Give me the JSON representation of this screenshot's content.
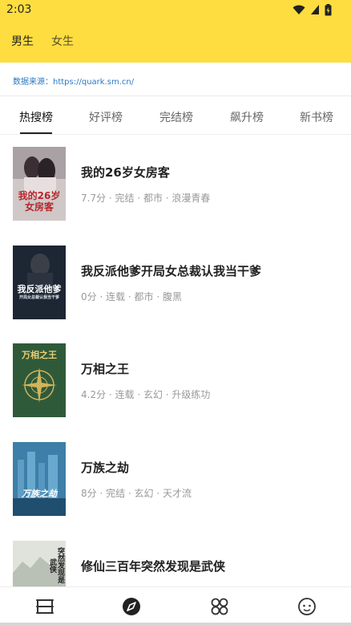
{
  "status_bar": {
    "time": "2:03",
    "icons": [
      "wifi-icon",
      "signal-icon",
      "battery-icon"
    ]
  },
  "header": {
    "tabs": [
      {
        "label": "男生",
        "active": true
      },
      {
        "label": "女生",
        "active": false
      }
    ],
    "background_color": "#FDDD3F"
  },
  "source": {
    "label": "数据来源：",
    "url": "https://quark.sm.cn/"
  },
  "rank_tabs": [
    {
      "label": "热搜榜",
      "active": true
    },
    {
      "label": "好评榜",
      "active": false
    },
    {
      "label": "完结榜",
      "active": false
    },
    {
      "label": "飙升榜",
      "active": false
    },
    {
      "label": "新书榜",
      "active": false
    }
  ],
  "books": [
    {
      "title": "我的26岁女房客",
      "meta": "7.7分 · 完结 · 都市 · 浪漫青春",
      "cover_text": "我的26岁女房客",
      "cover_color": "#c9c2c0"
    },
    {
      "title": "我反派他爹开局女总裁认我当干爹",
      "meta": "0分 · 连载 · 都市 · 腹黑",
      "cover_text": "我反派他爹",
      "cover_sub": "开局女总裁认我当干爹",
      "cover_color": "#1d2633"
    },
    {
      "title": "万相之王",
      "meta": "4.2分 · 连载 · 玄幻 · 升级练功",
      "cover_text": "万相之王",
      "cover_color": "#2f5a3a"
    },
    {
      "title": "万族之劫",
      "meta": "8分 · 完结 · 玄幻 · 天才流",
      "cover_text": "万族之劫",
      "cover_color": "#3d7fa8"
    },
    {
      "title": "修仙三百年突然发现是武侠",
      "meta": "",
      "cover_text": "突然发现是武侠",
      "cover_color": "#dfe3dc"
    }
  ],
  "bottom_nav": [
    {
      "icon": "bookshelf-icon",
      "active": false
    },
    {
      "icon": "compass-icon",
      "active": true
    },
    {
      "icon": "category-icon",
      "active": false
    },
    {
      "icon": "profile-icon",
      "active": false
    }
  ]
}
